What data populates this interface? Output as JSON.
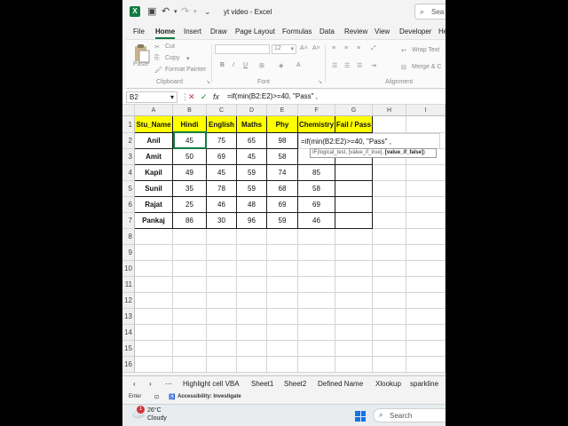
{
  "titlebar": {
    "title": "yt video  -  Excel",
    "search_placeholder": "Sea"
  },
  "ribbon_tabs": [
    "File",
    "Home",
    "Insert",
    "Draw",
    "Page Layout",
    "Formulas",
    "Data",
    "Review",
    "View",
    "Developer",
    "He"
  ],
  "ribbon": {
    "clipboard": {
      "paste": "Paste",
      "cut": "Cut",
      "copy": "Copy",
      "format_painter": "Format Painter",
      "group": "Clipboard"
    },
    "font": {
      "size": "12",
      "group": "Font"
    },
    "alignment": {
      "wrap_text": "Wrap Text",
      "merge": "Merge & C",
      "group": "Alignment"
    }
  },
  "formula_bar": {
    "name_box": "B2",
    "formula": "=if(min(B2:E2)>=40, \"Pass\" ,"
  },
  "columns": [
    "A",
    "B",
    "C",
    "D",
    "E",
    "F",
    "G",
    "H",
    "I"
  ],
  "rows": [
    "1",
    "2",
    "3",
    "4",
    "5",
    "6",
    "7",
    "8",
    "9",
    "10",
    "11",
    "12",
    "13",
    "14",
    "15",
    "16"
  ],
  "table": {
    "headers": [
      "Stu_Name",
      "Hindi",
      "English",
      "Maths",
      "Phy",
      "Chemistry",
      "Fail / Pass"
    ],
    "records": [
      [
        "Anil",
        "45",
        "75",
        "65",
        "98",
        "",
        ""
      ],
      [
        "Amit",
        "50",
        "69",
        "45",
        "58",
        "",
        ""
      ],
      [
        "Kapil",
        "49",
        "45",
        "59",
        "74",
        "85",
        ""
      ],
      [
        "Sunil",
        "35",
        "78",
        "59",
        "68",
        "58",
        ""
      ],
      [
        "Rajat",
        "25",
        "46",
        "48",
        "69",
        "69",
        ""
      ],
      [
        "Pankaj",
        "86",
        "30",
        "96",
        "59",
        "46",
        ""
      ]
    ],
    "editing_cell_text": "=if(min(B2:E2)>=40, \"Pass\" ,"
  },
  "tooltip": {
    "part1": "IF(logical_test, [value_if_true], ",
    "part2": "[value_if_false]",
    "part3": ")"
  },
  "sheet_tabs": [
    "Highlight cell VBA",
    "Sheet1",
    "Sheet2",
    "Defined Name",
    "Xlookup",
    "sparkline"
  ],
  "status": {
    "mode": "Enter",
    "accessibility": "Accessibility: Investigate"
  },
  "taskbar": {
    "temperature": "26°C",
    "condition": "Cloudy",
    "notification_count": "1",
    "search": "Search"
  },
  "colors": {
    "excel_green": "#107c41",
    "header_yellow": "#ffff00"
  }
}
